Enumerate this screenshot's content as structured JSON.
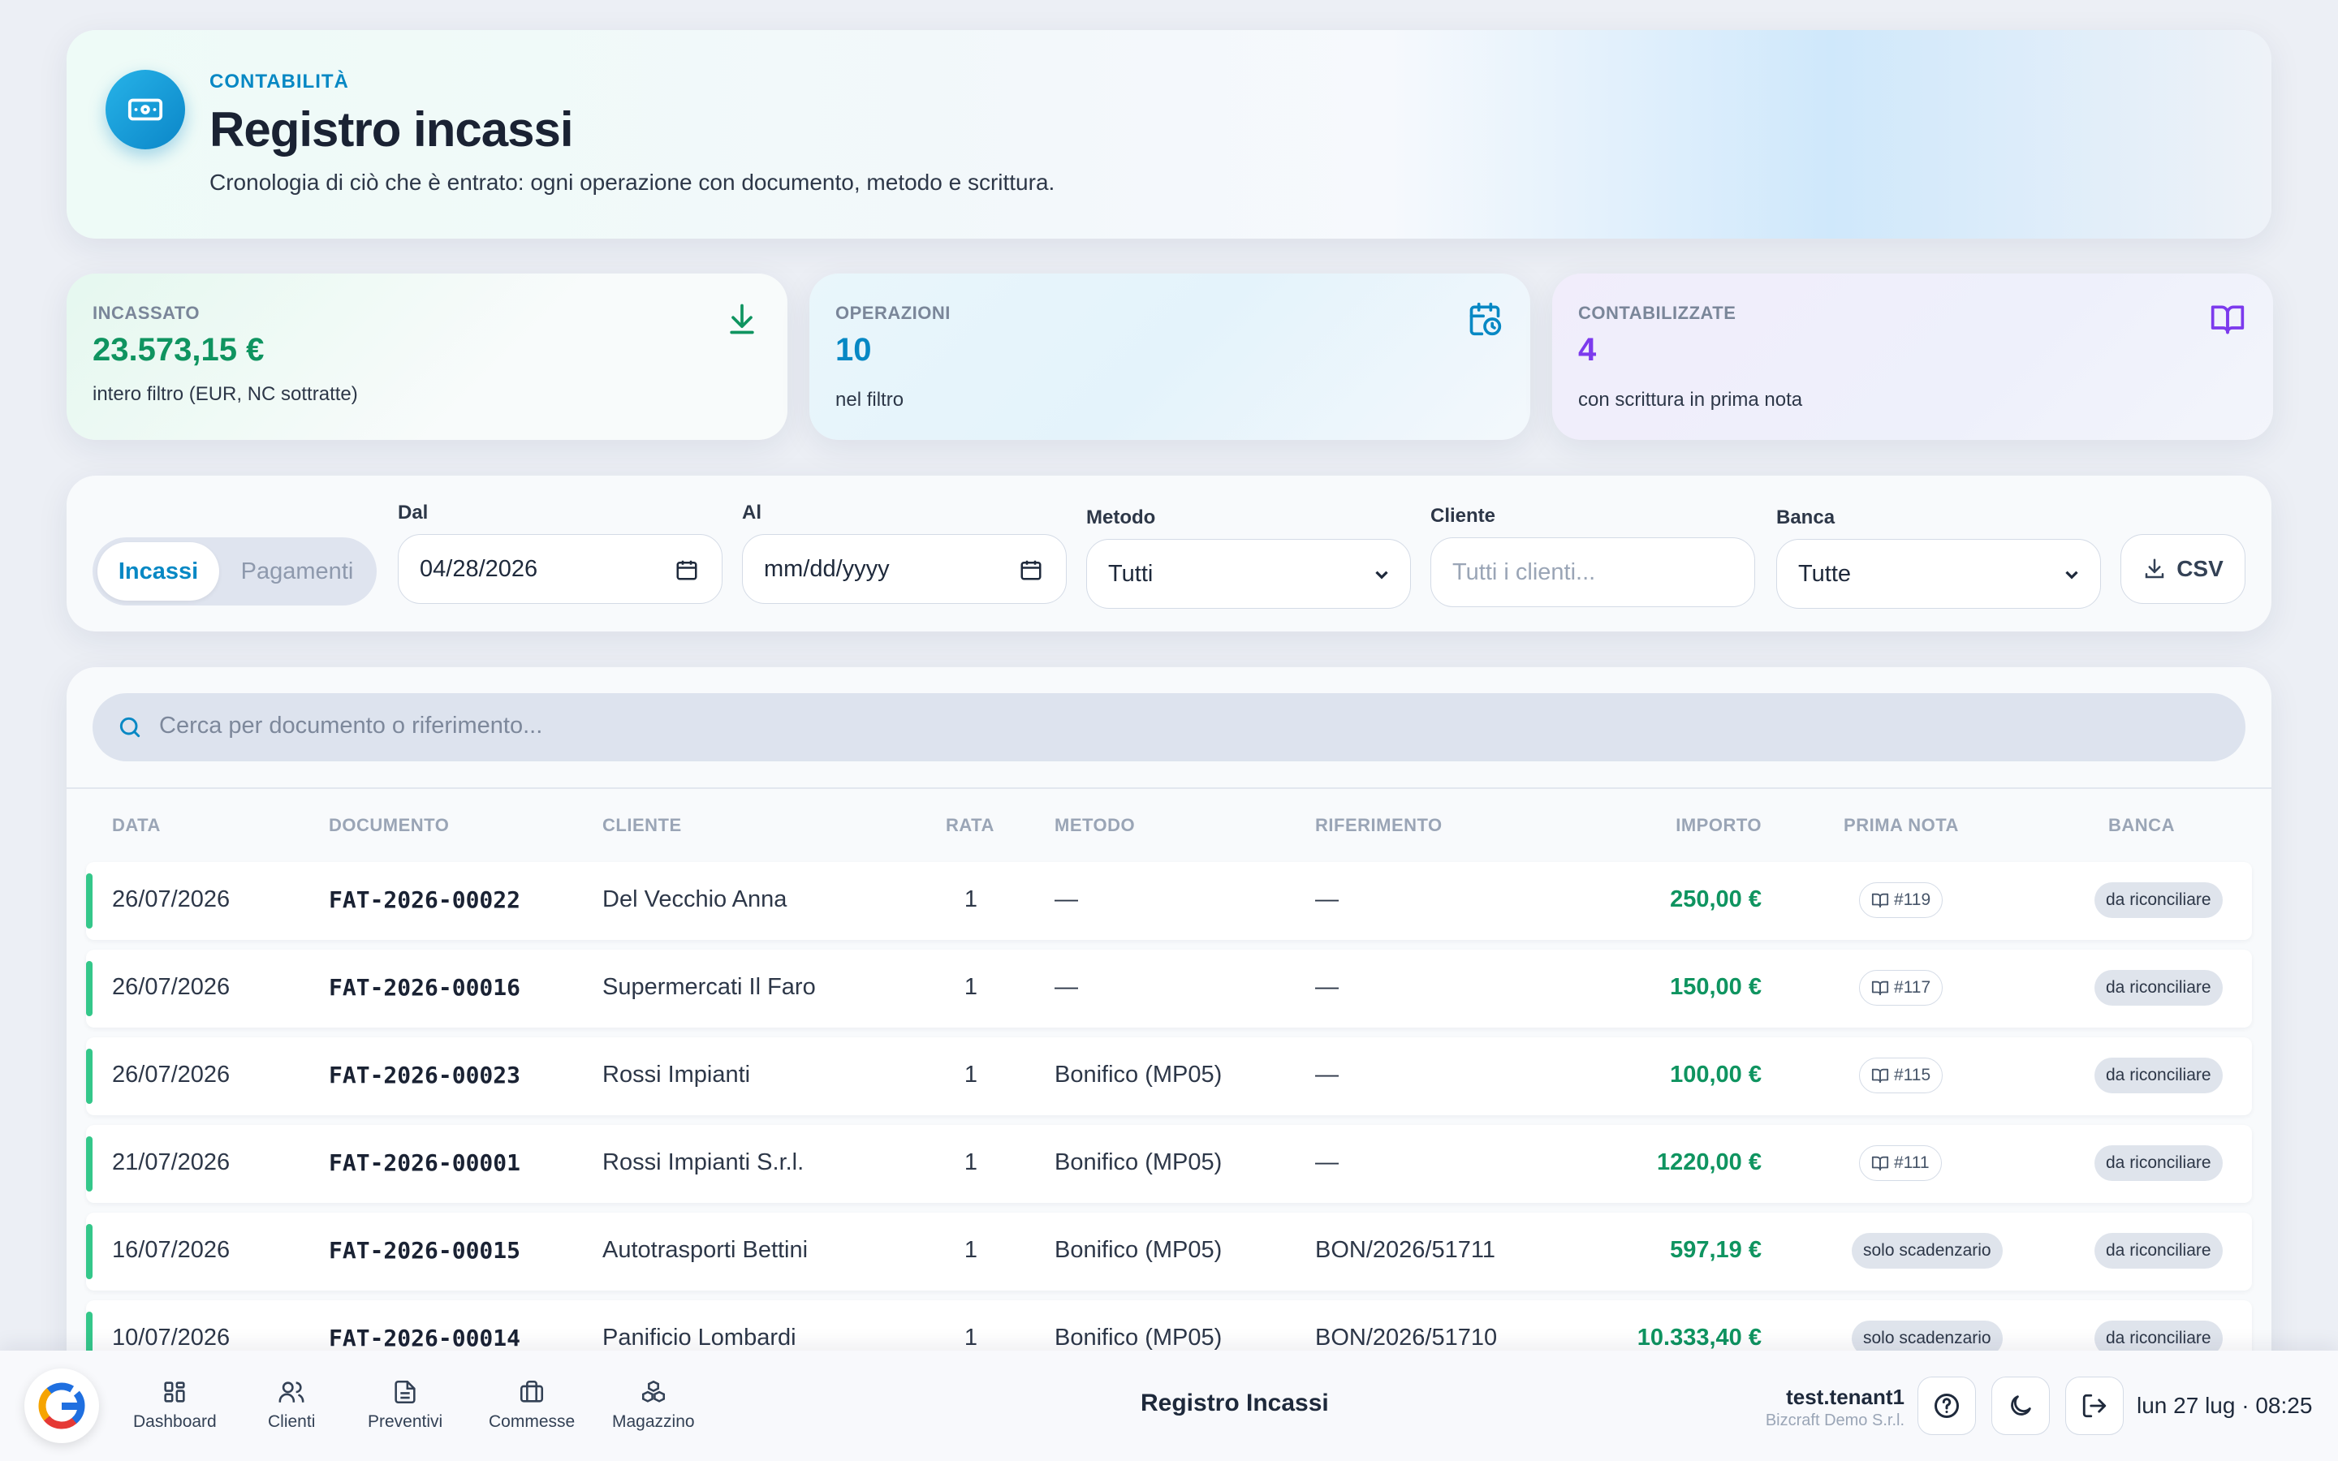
{
  "header": {
    "kicker": "CONTABILITÀ",
    "title": "Registro incassi",
    "subtitle": "Cronologia di ciò che è entrato: ogni operazione con documento, metodo e scrittura."
  },
  "stats": [
    {
      "label": "INCASSATO",
      "value": "23.573,15 €",
      "caption": "intero filtro (EUR, NC sottratte)",
      "icon": "download-icon",
      "color": "#0f9460"
    },
    {
      "label": "OPERAZIONI",
      "value": "10",
      "caption": "nel filtro",
      "icon": "calendar-clock-icon",
      "color": "#0788c4"
    },
    {
      "label": "CONTABILIZZATE",
      "value": "4",
      "caption": "con scrittura in prima nota",
      "icon": "book-open-icon",
      "color": "#7c3aed"
    }
  ],
  "filters": {
    "segment": {
      "active": "Incassi",
      "inactive": "Pagamenti"
    },
    "from": {
      "label": "Dal",
      "value": "04/28/2026"
    },
    "to": {
      "label": "Al",
      "value": "mm/dd/yyyy"
    },
    "method": {
      "label": "Metodo",
      "value": "Tutti"
    },
    "client": {
      "label": "Cliente",
      "placeholder": "Tutti i clienti..."
    },
    "bank": {
      "label": "Banca",
      "value": "Tutte"
    },
    "csv_label": "CSV"
  },
  "search": {
    "placeholder": "Cerca per documento o riferimento..."
  },
  "table": {
    "columns": [
      "DATA",
      "DOCUMENTO",
      "CLIENTE",
      "RATA",
      "METODO",
      "RIFERIMENTO",
      "IMPORTO",
      "PRIMA NOTA",
      "BANCA"
    ],
    "rows": [
      {
        "date": "26/07/2026",
        "doc": "FAT-2026-00022",
        "client": "Del Vecchio Anna",
        "rata": "1",
        "method": "—",
        "ref": "—",
        "amount": "250,00 €",
        "prima_nota": "#119",
        "prima_nota_type": "link",
        "bank": "da riconciliare"
      },
      {
        "date": "26/07/2026",
        "doc": "FAT-2026-00016",
        "client": "Supermercati Il Faro",
        "rata": "1",
        "method": "—",
        "ref": "—",
        "amount": "150,00 €",
        "prima_nota": "#117",
        "prima_nota_type": "link",
        "bank": "da riconciliare"
      },
      {
        "date": "26/07/2026",
        "doc": "FAT-2026-00023",
        "client": "Rossi Impianti",
        "rata": "1",
        "method": "Bonifico (MP05)",
        "ref": "—",
        "amount": "100,00 €",
        "prima_nota": "#115",
        "prima_nota_type": "link",
        "bank": "da riconciliare"
      },
      {
        "date": "21/07/2026",
        "doc": "FAT-2026-00001",
        "client": "Rossi Impianti S.r.l.",
        "rata": "1",
        "method": "Bonifico (MP05)",
        "ref": "—",
        "amount": "1220,00 €",
        "prima_nota": "#111",
        "prima_nota_type": "link",
        "bank": "da riconciliare"
      },
      {
        "date": "16/07/2026",
        "doc": "FAT-2026-00015",
        "client": "Autotrasporti Bettini",
        "rata": "1",
        "method": "Bonifico (MP05)",
        "ref": "BON/2026/51711",
        "amount": "597,19 €",
        "prima_nota": "solo scadenzario",
        "prima_nota_type": "badge",
        "bank": "da riconciliare"
      },
      {
        "date": "10/07/2026",
        "doc": "FAT-2026-00014",
        "client": "Panificio Lombardi",
        "rata": "1",
        "method": "Bonifico (MP05)",
        "ref": "BON/2026/51710",
        "amount": "10.333,40 €",
        "prima_nota": "solo scadenzario",
        "prima_nota_type": "badge",
        "bank": "da riconciliare"
      }
    ]
  },
  "bottom_bar": {
    "nav": [
      {
        "label": "Dashboard",
        "icon": "grid-icon"
      },
      {
        "label": "Clienti",
        "icon": "users-icon"
      },
      {
        "label": "Preventivi",
        "icon": "document-icon"
      },
      {
        "label": "Commesse",
        "icon": "briefcase-icon"
      },
      {
        "label": "Magazzino",
        "icon": "boxes-icon"
      }
    ],
    "page_title": "Registro Incassi",
    "user": "test.tenant1",
    "tenant": "Bizcraft Demo S.r.l.",
    "clock": "lun 27 lug · 08:25"
  }
}
